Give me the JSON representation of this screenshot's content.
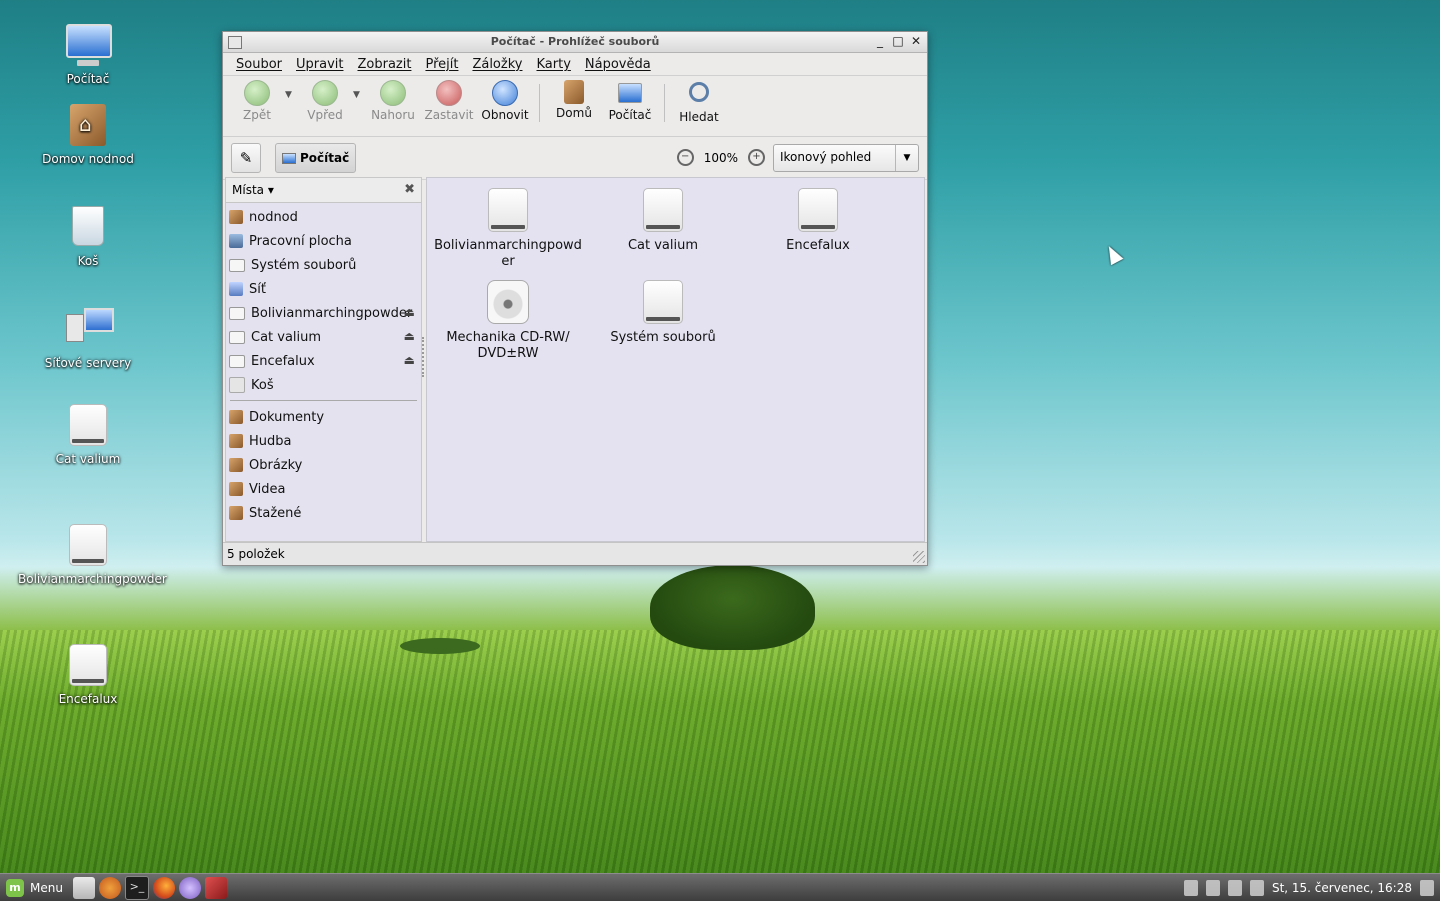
{
  "desktop": {
    "icons": [
      {
        "label": "Počítač",
        "icon": "computer-icon"
      },
      {
        "label": "Domov nodnod",
        "icon": "home-folder-icon"
      },
      {
        "label": "Koš",
        "icon": "trash-icon"
      },
      {
        "label": "Síťové servery",
        "icon": "network-servers-icon"
      },
      {
        "label": "Cat valium",
        "icon": "drive-icon"
      },
      {
        "label": "Bolivianmarchingpowder",
        "icon": "drive-icon"
      },
      {
        "label": "Encefalux",
        "icon": "drive-icon"
      }
    ]
  },
  "window": {
    "title": "Počítač - Prohlížeč souborů",
    "controls": {
      "minimize": "_",
      "maximize": "□",
      "close": "✕"
    },
    "menubar": [
      "Soubor",
      "Upravit",
      "Zobrazit",
      "Přejít",
      "Záložky",
      "Karty",
      "Nápověda"
    ],
    "toolbar": {
      "back": "Zpět",
      "forward": "Vpřed",
      "up": "Nahoru",
      "stop": "Zastavit",
      "reload": "Obnovit",
      "home": "Domů",
      "computer": "Počítač",
      "search": "Hledat"
    },
    "location": {
      "current": "Počítač",
      "zoom": "100%",
      "view_mode": "Ikonový pohled"
    },
    "sidebar": {
      "header": "Místa",
      "places": [
        {
          "label": "nodnod",
          "icon": "home-folder-icon"
        },
        {
          "label": "Pracovní plocha",
          "icon": "desktop-icon"
        },
        {
          "label": "Systém souborů",
          "icon": "drive-icon"
        },
        {
          "label": "Síť",
          "icon": "network-icon"
        },
        {
          "label": "Bolivianmarchingpowder",
          "icon": "drive-icon",
          "eject": "⏏"
        },
        {
          "label": "Cat valium",
          "icon": "drive-icon",
          "eject": "⏏"
        },
        {
          "label": "Encefalux",
          "icon": "drive-icon",
          "eject": "⏏"
        },
        {
          "label": "Koš",
          "icon": "trash-icon"
        }
      ],
      "bookmarks": [
        {
          "label": "Dokumenty"
        },
        {
          "label": "Hudba"
        },
        {
          "label": "Obrázky"
        },
        {
          "label": "Videa"
        },
        {
          "label": "Stažené"
        }
      ]
    },
    "content": {
      "items": [
        {
          "label": "Bolivianmarchingpowd er",
          "icon": "drive-icon"
        },
        {
          "label": "Cat valium",
          "icon": "drive-icon"
        },
        {
          "label": "Encefalux",
          "icon": "drive-icon"
        },
        {
          "label": "Mechanika CD-RW/ DVD±RW",
          "icon": "cd-drive-icon"
        },
        {
          "label": "Systém souborů",
          "icon": "drive-icon"
        }
      ]
    },
    "status": "5 položek"
  },
  "panel": {
    "menu_label": "Menu",
    "clock": "St, 15. červenec, 16:28"
  }
}
